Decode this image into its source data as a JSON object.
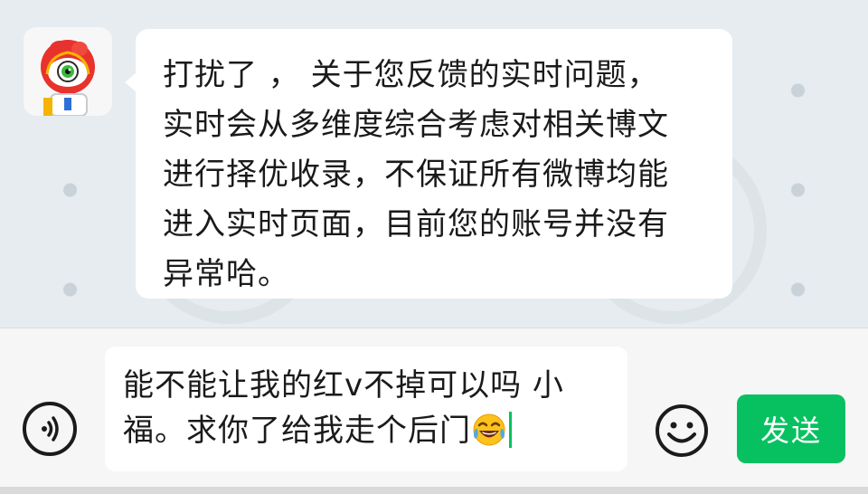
{
  "incoming_message": {
    "lines": [
      "打扰了 ， 关于您反馈的实时问题，",
      "实时会从多维度综合考虑对相关博文",
      "进行择优收录，不保证所有微博均能",
      "进入实时页面，目前您的账号并没有",
      "异常哈。"
    ]
  },
  "composer": {
    "line1": "能不能让我的红v不掉可以吗 小",
    "line2": "福。求你了给我走个后门",
    "emoji": "face-with-tears-of-joy",
    "send_label": "发送"
  },
  "icons": {
    "avatar": "weibo-mascot-avatar",
    "voice": "voice-input-icon",
    "emoji_button": "smiley-icon"
  },
  "colors": {
    "send_green": "#07c160",
    "avatar_red": "#e8322d"
  }
}
